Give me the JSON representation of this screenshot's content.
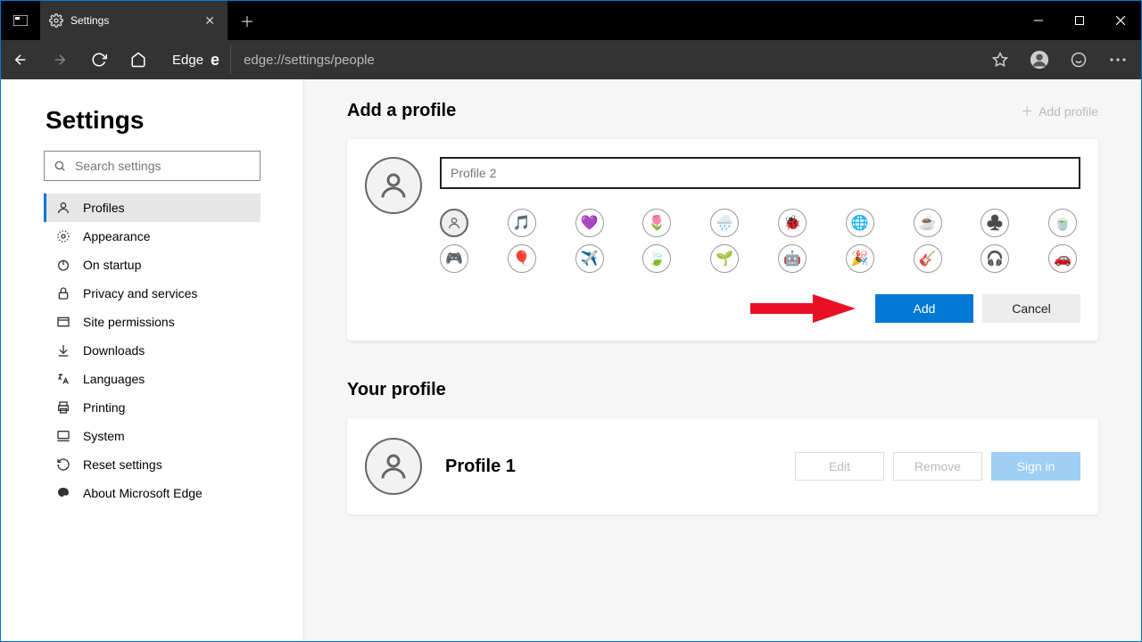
{
  "tab": {
    "title": "Settings"
  },
  "toolbar": {
    "edge_label": "Edge",
    "url": "edge://settings/people"
  },
  "sidebar": {
    "title": "Settings",
    "search_placeholder": "Search settings",
    "items": [
      {
        "id": "profiles",
        "label": "Profiles"
      },
      {
        "id": "appearance",
        "label": "Appearance"
      },
      {
        "id": "on-startup",
        "label": "On startup"
      },
      {
        "id": "privacy",
        "label": "Privacy and services"
      },
      {
        "id": "site-permissions",
        "label": "Site permissions"
      },
      {
        "id": "downloads",
        "label": "Downloads"
      },
      {
        "id": "languages",
        "label": "Languages"
      },
      {
        "id": "printing",
        "label": "Printing"
      },
      {
        "id": "system",
        "label": "System"
      },
      {
        "id": "reset",
        "label": "Reset settings"
      },
      {
        "id": "about",
        "label": "About Microsoft Edge"
      }
    ]
  },
  "add_profile": {
    "heading": "Add a profile",
    "link": "Add profile",
    "name_placeholder": "Profile 2",
    "add_label": "Add",
    "cancel_label": "Cancel",
    "icons": [
      "person",
      "music",
      "heart",
      "flower",
      "cloud",
      "ladybug",
      "globe",
      "cup",
      "cards",
      "tea",
      "gamepad",
      "balloons",
      "plane",
      "leaf",
      "plant",
      "robot",
      "confetti",
      "guitar",
      "headphones",
      "car"
    ]
  },
  "your_profile": {
    "heading": "Your profile",
    "name": "Profile 1",
    "edit": "Edit",
    "remove": "Remove",
    "sign_in": "Sign in"
  }
}
